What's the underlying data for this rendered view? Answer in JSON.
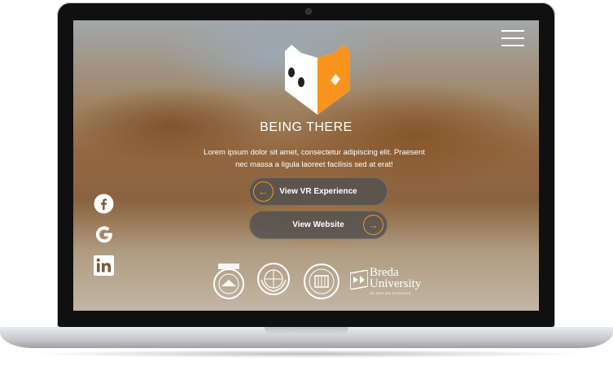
{
  "hero": {
    "title": "BEING THERE",
    "tagline": "Lorem ipsum dolor sit amet, consectetur adipiscing elit. Praesent nec massa a ligula laoreet facilisis sed at erat!"
  },
  "buttons": {
    "vr_label": "View VR Experience",
    "website_label": "View Website"
  },
  "social": [
    "facebook-icon",
    "google-icon",
    "linkedin-icon"
  ],
  "partners": {
    "breda_line1": "Breda",
    "breda_line2": "University",
    "breda_sub": "OF APPLIED SCIENCES"
  },
  "colors": {
    "accent": "#f7941d",
    "pill_bg": "#505050",
    "text": "#ffffff"
  }
}
